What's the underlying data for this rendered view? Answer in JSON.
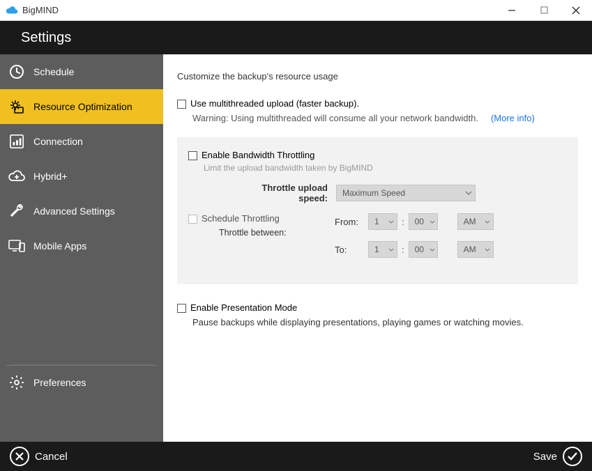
{
  "titlebar": {
    "app_name": "BigMIND"
  },
  "header": {
    "title": "Settings"
  },
  "sidebar": {
    "items": [
      {
        "label": "Schedule"
      },
      {
        "label": "Resource Optimization"
      },
      {
        "label": "Connection"
      },
      {
        "label": "Hybrid+"
      },
      {
        "label": "Advanced Settings"
      },
      {
        "label": "Mobile Apps"
      }
    ],
    "preferences_label": "Preferences"
  },
  "content": {
    "heading": "Customize the backup's resource usage",
    "multithreaded": {
      "label": "Use multithreaded upload (faster backup).",
      "warning": "Warning: Using multithreaded will consume all your network bandwidth.",
      "more_info": "(More info)"
    },
    "throttling": {
      "enable_label": "Enable Bandwidth Throttling",
      "sub": "Limit the upload bandwidth taken by BigMIND",
      "speed_label": "Throttle upload speed:",
      "speed_value": "Maximum Speed",
      "schedule_label": "Schedule Throttling",
      "between_label": "Throttle between:",
      "from_label": "From:",
      "to_label": "To:",
      "from": {
        "hour": "1",
        "minute": "00",
        "ampm": "AM"
      },
      "to": {
        "hour": "1",
        "minute": "00",
        "ampm": "AM"
      }
    },
    "presentation": {
      "label": "Enable Presentation Mode",
      "desc": "Pause backups while displaying presentations, playing games or watching movies."
    }
  },
  "footer": {
    "cancel": "Cancel",
    "save": "Save"
  }
}
